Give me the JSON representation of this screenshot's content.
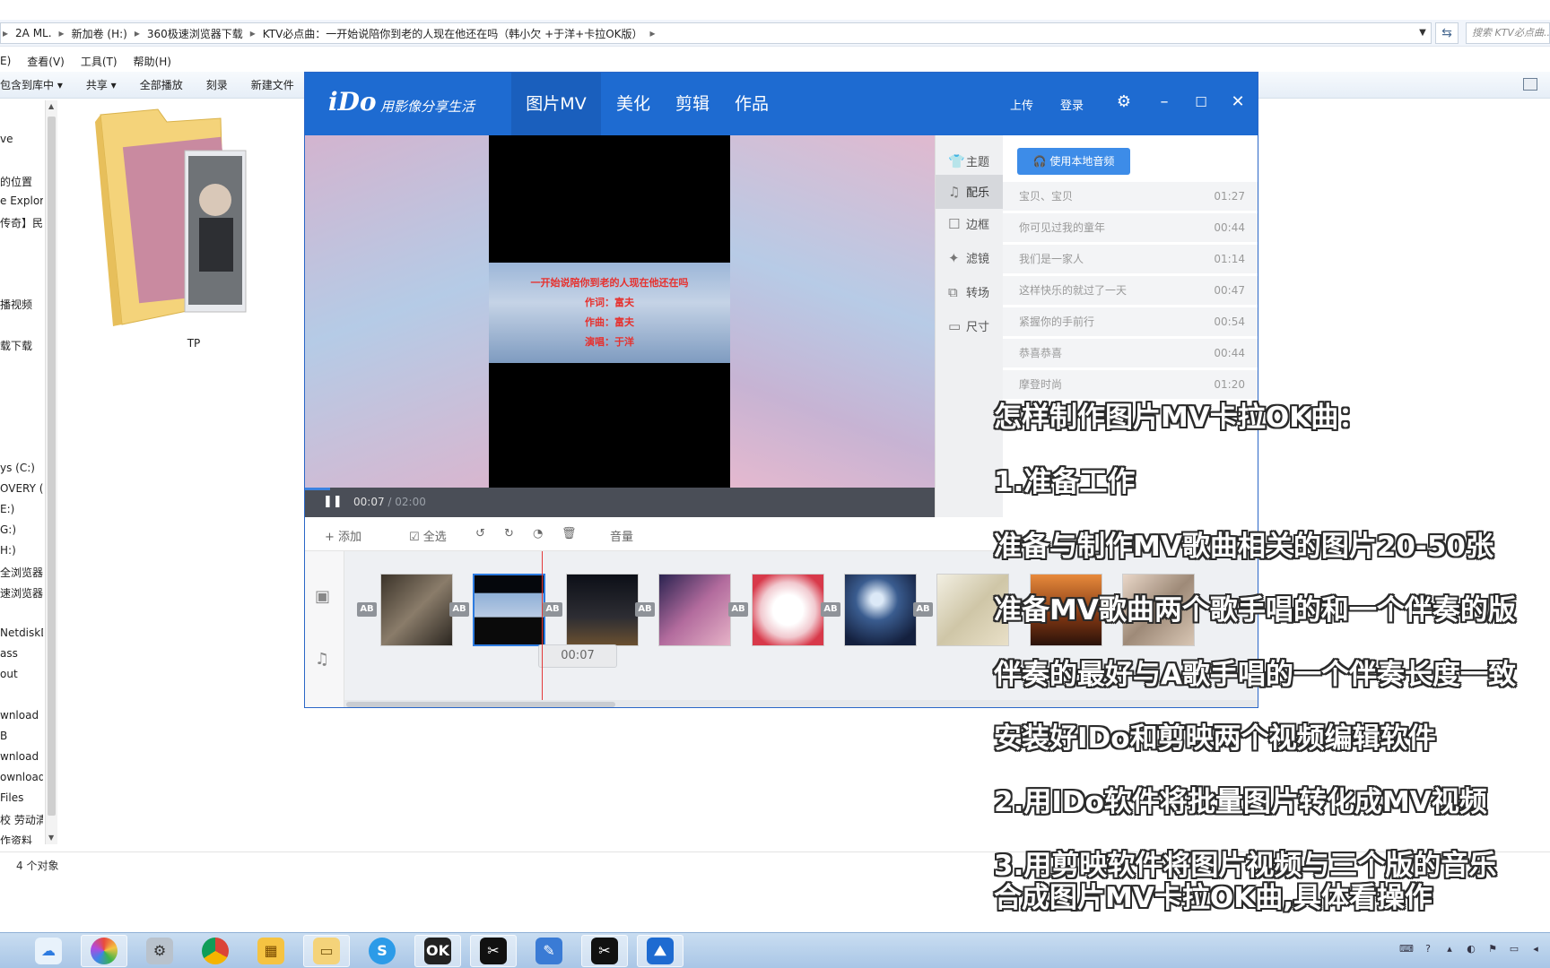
{
  "explorer": {
    "address": [
      "2A ML.",
      "新加卷 (H:)",
      "360极速浏览器下载",
      "KTV必点曲：一开始说陪你到老的人现在他还在吗（韩小欠 +于洋+卡拉OK版）"
    ],
    "search_placeholder": "搜索 KTV必点曲...",
    "menu": [
      "E)",
      "查看(V)",
      "工具(T)",
      "帮助(H)"
    ],
    "commands": [
      "包含到库中 ▾",
      "共享 ▾",
      "全部播放",
      "刻录",
      "新建文件"
    ],
    "nav_items": [
      "ve",
      "的位置",
      "e Explore",
      "传奇】民族",
      "播视频",
      "载下载",
      "ys (C:)",
      "OVERY (",
      "E:)",
      "G:)",
      "H:)",
      "全浏览器",
      "速浏览器",
      "NetdiskD",
      "ass",
      "out",
      "wnload",
      "B",
      "wnload",
      "ownload",
      "Files",
      "校 劳动清",
      "作资料"
    ],
    "folder_label": "TP",
    "status": "4 个对象"
  },
  "ido": {
    "logo": "iDo",
    "slogan": "用影像分享生活",
    "tabs": [
      "图片MV",
      "美化",
      "剪辑",
      "作品"
    ],
    "upload": "上传",
    "login": "登录",
    "time_current": "00:07",
    "time_total": " / 02:00",
    "video_lines": [
      "一开始说陪你到老的人现在他还在吗",
      "作词：富夫",
      "作曲：富夫",
      "演唱：于洋"
    ],
    "side_nav": [
      "主题",
      "配乐",
      "边框",
      "滤镜",
      "转场",
      "尺寸"
    ],
    "local_audio_btn": "使用本地音频",
    "songs": [
      {
        "name": "宝贝、宝贝",
        "dur": "01:27"
      },
      {
        "name": "你可见过我的童年",
        "dur": "00:44"
      },
      {
        "name": "我们是一家人",
        "dur": "01:14"
      },
      {
        "name": "这样快乐的就过了一天",
        "dur": "00:47"
      },
      {
        "name": "紧握你的手前行",
        "dur": "00:54"
      },
      {
        "name": "恭喜恭喜",
        "dur": "00:44"
      },
      {
        "name": "摩登时尚",
        "dur": "01:20"
      }
    ],
    "toolbar": {
      "add": "添加",
      "select_all": "全选",
      "volume": "音量"
    },
    "clip_time": "00:07",
    "ab_label": "AB"
  },
  "overlay": [
    "怎样制作图片MV卡拉OK曲：",
    "1.准备工作",
    "准备与制作MV歌曲相关的图片20-50张",
    "准备MV歌曲两个歌手唱的和一个伴奏的版",
    "伴奏的最好与A歌手唱的一个伴奏长度一致",
    "安装好IDo和剪映两个视频编辑软件",
    "2.用IDo软件将批量图片转化成MV视频",
    "3.用剪映软件将图片视频与三个版的音乐",
    "合成图片MV卡拉OK曲,具体看操作"
  ],
  "colors": {
    "ido_blue": "#1e6bd1",
    "accent_btn": "#3d8ce8",
    "playhead": "#e33a3a"
  },
  "icons": [
    "settings-icon",
    "minimize-icon",
    "maximize-icon",
    "close-icon",
    "pause-icon",
    "shirt-icon",
    "music-icon",
    "border-icon",
    "filter-icon",
    "transition-icon",
    "size-icon",
    "headphone-icon",
    "plus-icon",
    "rotate-left-icon",
    "rotate-right-icon",
    "clock-icon",
    "trash-icon",
    "add-video-icon",
    "add-music-icon"
  ]
}
